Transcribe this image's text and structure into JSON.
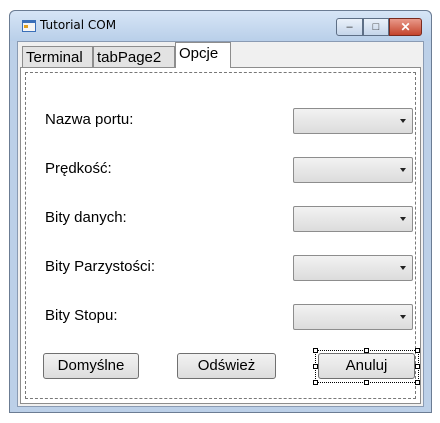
{
  "window": {
    "title": "Tutorial COM"
  },
  "tabs": [
    {
      "label": "Terminal",
      "active": false
    },
    {
      "label": "tabPage2",
      "active": false
    },
    {
      "label": "Opcje",
      "active": true
    }
  ],
  "options": {
    "port_label": "Nazwa portu:",
    "speed_label": "Prędkość:",
    "databits_label": "Bity danych:",
    "parity_label": "Bity Parzystości:",
    "stopbits_label": "Bity Stopu:",
    "port_value": "",
    "speed_value": "",
    "databits_value": "",
    "parity_value": "",
    "stopbits_value": ""
  },
  "buttons": {
    "default_label": "Domyślne",
    "refresh_label": "Odśwież",
    "cancel_label": "Anuluj"
  }
}
